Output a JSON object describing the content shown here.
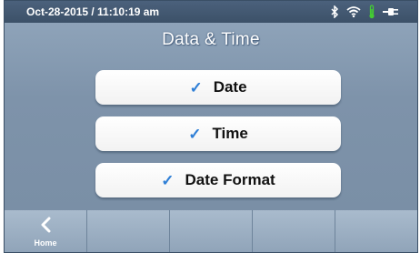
{
  "status": {
    "datetime": "Oct-28-2015 / 11:10:19 am",
    "icons": [
      "bluetooth-icon",
      "wifi-icon",
      "thermometer-icon",
      "plug-icon"
    ]
  },
  "screen": {
    "title": "Data & Time",
    "options": [
      {
        "label": "Date",
        "checked": true
      },
      {
        "label": "Time",
        "checked": true
      },
      {
        "label": "Date Format",
        "checked": true
      }
    ]
  },
  "nav": {
    "home_label": "Home"
  },
  "colors": {
    "accent_check": "#2f7fd6",
    "status_bar": "#43586f",
    "thermometer": "#44cc33"
  }
}
